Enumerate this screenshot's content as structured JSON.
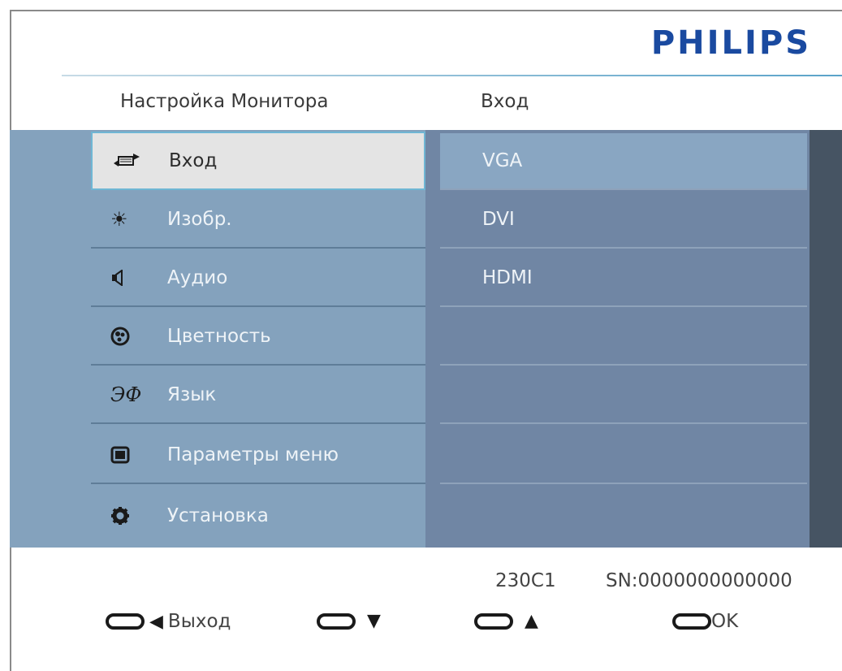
{
  "brand": "PHILIPS",
  "header": {
    "left": "Настройка Монитора",
    "right": "Вход"
  },
  "menu": [
    {
      "label": "Вход",
      "icon": "input-icon",
      "selected": true
    },
    {
      "label": "Изобр.",
      "icon": "brightness-icon"
    },
    {
      "label": "Аудио",
      "icon": "speaker-icon"
    },
    {
      "label": "Цветность",
      "icon": "color-icon"
    },
    {
      "label": "Язык",
      "icon": "language-icon"
    },
    {
      "label": "Параметры меню",
      "icon": "menu-settings-icon"
    },
    {
      "label": "Установка",
      "icon": "setup-icon"
    }
  ],
  "options": [
    {
      "label": "VGA",
      "selected": true
    },
    {
      "label": "DVI"
    },
    {
      "label": "HDMI"
    },
    {
      "label": ""
    },
    {
      "label": ""
    },
    {
      "label": ""
    },
    {
      "label": ""
    }
  ],
  "footer": {
    "model": "230C1",
    "serial": "SN:0000000000000",
    "controls": {
      "exit": "Выход",
      "down": "▼",
      "up": "▲",
      "ok": "OK"
    }
  }
}
